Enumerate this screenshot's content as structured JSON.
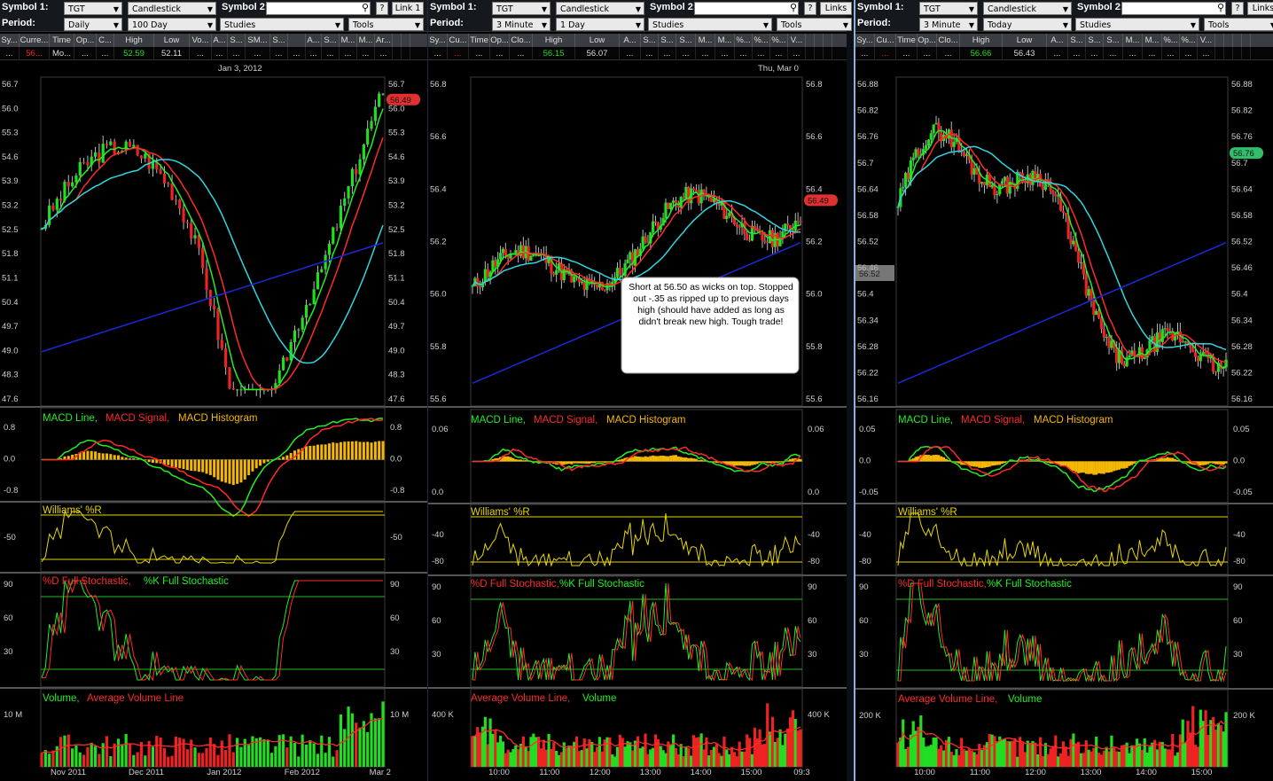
{
  "colors": {
    "up": "#22dd22",
    "down": "#ee2222",
    "ma_red": "#ff2a2a",
    "ma_green": "#22ee22",
    "ma_cyan": "#2fd6e0",
    "ma_blue": "#1b2ad8",
    "macd_line": "#22ee22",
    "macd_signal": "#ff2a2a",
    "histogram": "#f5b800",
    "williams": "#e6d600",
    "axis_text": "#cfcfcf",
    "price_tag_red": "#e03030",
    "price_tag_green": "#2fbf6a"
  },
  "icons": {
    "search": "magnifier-icon",
    "help": "question-mark-icon",
    "dropdown": "chevron-down-icon"
  },
  "windows": [
    {
      "symbol_label": "Symbol 1:",
      "symbol": "TGT",
      "chart_type": "Candlestick",
      "symbol2_label": "Symbol 2:",
      "help": "?",
      "link": "Link 1",
      "period_label": "Period:",
      "interval": "Daily",
      "range": "100 Day",
      "studies": "Studies",
      "tools": "Tools",
      "quote_headers": [
        "Sy...",
        "Curre...",
        "Time",
        "Op...",
        "C...",
        "High",
        "Low",
        "Vo...",
        "A...",
        "S...",
        "SM...",
        "S...",
        "",
        "A...",
        "S...",
        "M...",
        "M...",
        "Ar...",
        "",
        ""
      ],
      "quote_values": [
        "...",
        "56...",
        "Mo...",
        "...",
        "...",
        "52.59",
        "52.11",
        "...",
        "...",
        "...",
        "...",
        "...",
        "...",
        "...",
        "...",
        "...",
        "...",
        "...",
        "",
        ""
      ],
      "quote_widths": [
        22,
        34,
        28,
        25,
        20,
        45,
        40,
        25,
        18,
        20,
        28,
        20,
        20,
        18,
        20,
        20,
        20,
        20,
        10,
        10
      ],
      "hover_date": "Jan 3, 2012",
      "price_ticks": [
        "56.7",
        "56.0",
        "55.3",
        "54.6",
        "53.9",
        "53.2",
        "52.5",
        "51.8",
        "51.1",
        "50.4",
        "49.7",
        "49.0",
        "48.3",
        "47.6"
      ],
      "price_tag": "56.49",
      "macd_legend": [
        "MACD Line,",
        "MACD Signal,",
        "MACD Histogram"
      ],
      "macd_ticks": [
        "0.8",
        "0.0",
        "-0.8"
      ],
      "williams_legend": "Williams' %R",
      "williams_ticks": [
        "-50"
      ],
      "stoch_legend": [
        "%D Full Stochastic,",
        "%K Full Stochastic"
      ],
      "stoch_ticks": [
        "90",
        "60",
        "30"
      ],
      "volume_legend": [
        "Volume,",
        "Average Volume Line"
      ],
      "volume_ticks": [
        "10 M"
      ],
      "x_labels": [
        "Nov 2011",
        "Dec 2011",
        "Jan 2012",
        "Feb 2012",
        "Mar 2"
      ]
    },
    {
      "symbol_label": "Symbol 1:",
      "symbol": "TGT",
      "chart_type": "Candlestick",
      "symbol2_label": "Symbol 2:",
      "help": "?",
      "link": "Links",
      "period_label": "Period:",
      "interval": "3 Minute",
      "range": "1 Day",
      "studies": "Studies",
      "tools": "Tools",
      "quote_headers": [
        "Sy...",
        "Cu...",
        "Time",
        "Op...",
        "Clo...",
        "High",
        "Low",
        "A...",
        "S...",
        "S...",
        "S...",
        "M...",
        "M...",
        "%...",
        "%...",
        "%...",
        "V...",
        "",
        "",
        ""
      ],
      "quote_values": [
        "...",
        "...",
        "...",
        "...",
        "...",
        "56.15",
        "56.07",
        "...",
        "...",
        "...",
        "...",
        "...",
        "...",
        "...",
        "...",
        "...",
        "...",
        "",
        "",
        ""
      ],
      "quote_widths": [
        22,
        24,
        24,
        22,
        26,
        48,
        50,
        24,
        20,
        20,
        22,
        22,
        22,
        20,
        20,
        20,
        20,
        10,
        10,
        10
      ],
      "hover_date": "Thu, Mar 0",
      "price_ticks": [
        "56.8",
        "56.6",
        "56.4",
        "56.2",
        "56.0",
        "55.8",
        "55.6"
      ],
      "price_tag": "56.49",
      "annotation": "Short at 56.50 as wicks on top.  Stopped out -.35 as ripped up to previous days high (should have added as long as didn't break new high.  Tough trade!",
      "macd_legend": [
        "MACD Line,",
        "MACD Signal,",
        "MACD Histogram"
      ],
      "macd_ticks": [
        "0.06",
        "0.0"
      ],
      "williams_legend": "Williams' %R",
      "williams_ticks": [
        "-40",
        "-80"
      ],
      "stoch_legend": [
        "%D Full Stochastic,",
        "%K Full Stochastic"
      ],
      "stoch_ticks": [
        "90",
        "60",
        "30"
      ],
      "volume_legend": [
        "Average Volume Line,",
        "Volume"
      ],
      "volume_ticks": [
        "400 K"
      ],
      "x_labels": [
        "10:00",
        "11:00",
        "12:00",
        "13:00",
        "14:00",
        "15:00",
        "09:3"
      ]
    },
    {
      "symbol_label": "Symbol 1:",
      "symbol": "TGT",
      "chart_type": "Candlestick",
      "symbol2_label": "Symbol 2:",
      "help": "?",
      "link": "Links",
      "period_label": "Period:",
      "interval": "3 Minute",
      "range": "Today",
      "studies": "Studies",
      "tools": "Tools",
      "quote_headers": [
        "Sy...",
        "Cu...",
        "Time",
        "Op...",
        "Clo...",
        "High",
        "Low",
        "A...",
        "S...",
        "S...",
        "S...",
        "M...",
        "M...",
        "%...",
        "%...",
        "V...",
        "",
        "",
        "",
        ""
      ],
      "quote_values": [
        "...",
        "...",
        "...",
        "...",
        "...",
        "56.66",
        "56.43",
        "...",
        "...",
        "...",
        "...",
        "...",
        "...",
        "...",
        "...",
        "...",
        "",
        "",
        "",
        ""
      ],
      "quote_widths": [
        22,
        24,
        24,
        22,
        26,
        48,
        50,
        24,
        20,
        20,
        22,
        22,
        22,
        20,
        20,
        20,
        10,
        10,
        10,
        10
      ],
      "hover_date": "",
      "price_ticks": [
        "56.88",
        "56.82",
        "56.76",
        "56.7",
        "56.64",
        "56.58",
        "56.52",
        "56.46",
        "56.4",
        "56.34",
        "56.28",
        "56.22",
        "56.16"
      ],
      "price_tag": "56.76",
      "left_tag": "56.52",
      "macd_legend": [
        "MACD Line,",
        "MACD Signal,",
        "MACD Histogram"
      ],
      "macd_ticks": [
        "0.05",
        "0.0",
        "-0.05"
      ],
      "williams_legend": "Williams' %R",
      "williams_ticks": [
        "-40",
        "-80"
      ],
      "stoch_legend": [
        "%D Full Stochastic,",
        "%K Full Stochastic"
      ],
      "stoch_ticks": [
        "90",
        "60",
        "30"
      ],
      "volume_legend": [
        "Average Volume Line,",
        "Volume"
      ],
      "volume_ticks": [
        "200 K"
      ],
      "x_labels": [
        "10:00",
        "11:00",
        "12:00",
        "13:00",
        "14:00",
        "15:00"
      ]
    }
  ]
}
